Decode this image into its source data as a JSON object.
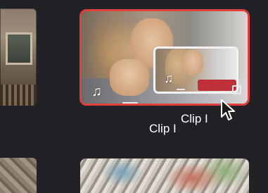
{
  "clips": {
    "main": {
      "label": "Clip I",
      "audio_icon": "music-note-icon"
    },
    "drag_preview": {
      "label": "Clip I",
      "audio_icon": "music-note-icon"
    }
  },
  "colors": {
    "background": "#222226",
    "selection_border": "#e0403c",
    "preview_border": "#f2f2f2",
    "label_text": "#ffffff"
  },
  "cursor": {
    "icon": "arrow-cursor-icon"
  }
}
